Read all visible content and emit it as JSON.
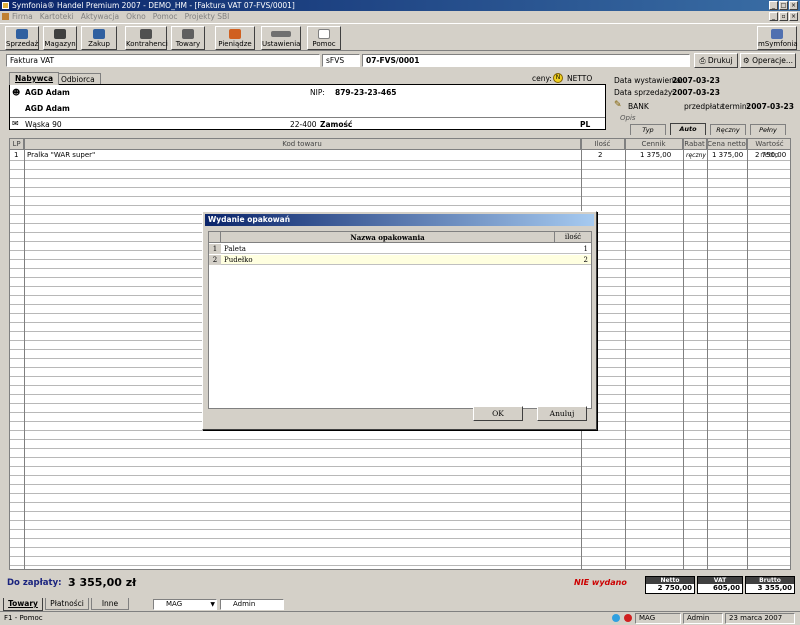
{
  "window": {
    "title": "Symfonia® Handel Premium 2007 - DEMO_HM - [Faktura VAT 07-FVS/0001]"
  },
  "menu": [
    "Firma",
    "Kartoteki",
    "Aktywacja",
    "Okno",
    "Pomoc",
    "Projekty SBI"
  ],
  "toolbar": {
    "buttons": [
      {
        "label": "Sprzedaż",
        "color": "#3060a0"
      },
      {
        "label": "Magazyn",
        "color": "#404040"
      },
      {
        "label": "Zakup",
        "color": "#3060a0"
      },
      {
        "label": "Kontrahenci",
        "color": "#505050"
      },
      {
        "label": "Towary",
        "color": "#606060"
      },
      {
        "label": "Pieniądze",
        "color": "#d06020"
      },
      {
        "label": "Ustawienia",
        "color": "#707070"
      },
      {
        "label": "Pomoc",
        "color": "#808080"
      }
    ],
    "msymfonia": "mSymfonia"
  },
  "doc": {
    "type": "Faktura VAT",
    "series": "sFVS",
    "number": "07-FVS/0001",
    "print_label": "Drukuj",
    "ops_label": "Operacje..."
  },
  "tabs": [
    "Nabywca",
    "Odbiorca"
  ],
  "prices": {
    "label": "ceny:",
    "mode": "NETTO"
  },
  "buyer": {
    "name": "AGD Adam",
    "nip_label": "NIP:",
    "nip": "879-23-23-465",
    "name2": "AGD Adam",
    "street": "Wąska 90",
    "postal": "22-400",
    "city": "Zamość",
    "country": "PL"
  },
  "dates": {
    "issue_label": "Data wystawienia:",
    "issue": "2007-03-23",
    "sale_label": "Data sprzedaży:",
    "sale": "2007-03-23"
  },
  "payment": {
    "method": "BANK",
    "advance_label": "przedpłata",
    "term_label": "termin:",
    "term": "2007-03-23",
    "desc_label": "Opis"
  },
  "subtabs": [
    "Typ",
    "Auto",
    "Ręczny",
    "Pełny"
  ],
  "grid": {
    "headers": [
      "LP",
      "Kod towaru",
      "Ilość",
      "Cennik",
      "Rabat",
      "Cena netto",
      "Wartość netto"
    ],
    "rows": [
      {
        "lp": "1",
        "name": "Pralka \"WAR super\"",
        "qty": "2",
        "price_list": "1 375,00",
        "discount": "ręczny",
        "net_price": "1 375,00",
        "net_value": "2 750,00"
      }
    ]
  },
  "dialog": {
    "title": "Wydanie opakowań",
    "headers": [
      "Nazwa opakowania",
      "ilość"
    ],
    "rows": [
      {
        "lp": "1",
        "name": "Paleta",
        "qty": "1"
      },
      {
        "lp": "2",
        "name": "Pudełko",
        "qty": "2"
      }
    ],
    "ok_label": "OK",
    "cancel_label": "Anuluj"
  },
  "footer": {
    "to_pay_label": "Do zapłaty:",
    "to_pay": "3 355,00  zł",
    "status": "NIE wydano",
    "netto_label": "Netto",
    "netto": "2 750,00",
    "vat_label": "VAT",
    "vat": "605,00",
    "brutto_label": "Brutto",
    "brutto": "3 355,00"
  },
  "bottom_tabs": [
    "Towary",
    "Płatności",
    "Inne"
  ],
  "bottom_fields": {
    "warehouse": "MAG",
    "user": "Admin"
  },
  "statusbar": {
    "help": "F1 - Pomoc",
    "warehouse": "MAG",
    "user": "Admin",
    "date": "23 marca 2007"
  }
}
